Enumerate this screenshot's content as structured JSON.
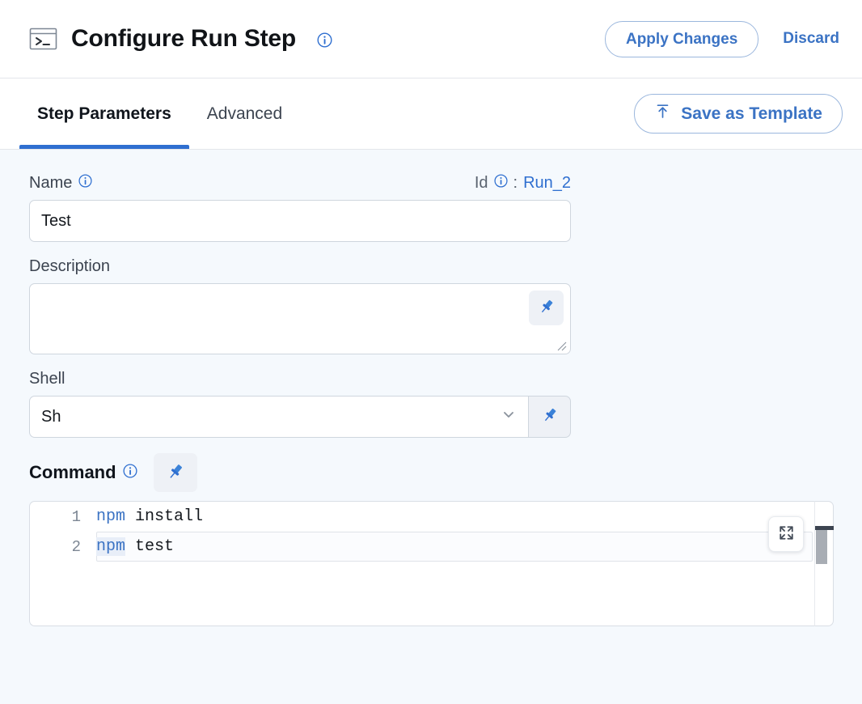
{
  "header": {
    "icon": "terminal-icon",
    "title": "Configure Run Step",
    "title_info_icon": "info-icon",
    "apply_label": "Apply Changes",
    "discard_label": "Discard"
  },
  "tabs": {
    "items": [
      {
        "label": "Step Parameters",
        "active": true
      },
      {
        "label": "Advanced",
        "active": false
      }
    ],
    "save_template_label": "Save as Template",
    "save_template_icon": "upload-icon"
  },
  "form": {
    "name": {
      "label": "Name",
      "info_icon": "info-icon",
      "value": "Test",
      "placeholder": ""
    },
    "id": {
      "label": "Id",
      "info_icon": "info-icon",
      "separator": ":",
      "value": "Run_2"
    },
    "description": {
      "label": "Description",
      "value": "",
      "placeholder": "",
      "pin_icon": "pin-icon"
    },
    "shell": {
      "label": "Shell",
      "value": "Sh",
      "chevron_icon": "chevron-down-icon",
      "pin_icon": "pin-icon"
    },
    "command": {
      "label": "Command",
      "info_icon": "info-icon",
      "pin_icon": "pin-icon",
      "expand_icon": "expand-icon",
      "lines": [
        {
          "num": "1",
          "keyword": "npm",
          "rest": " install",
          "active": false
        },
        {
          "num": "2",
          "keyword": "npm",
          "rest": " test",
          "active": true
        }
      ]
    }
  },
  "colors": {
    "accent": "#2f6fd0",
    "link": "#3b73c4",
    "page_bg": "#f5f9fd",
    "panel_bg": "#ffffff",
    "border": "#cfd6de",
    "text": "#14181d",
    "muted": "#5a636f"
  }
}
